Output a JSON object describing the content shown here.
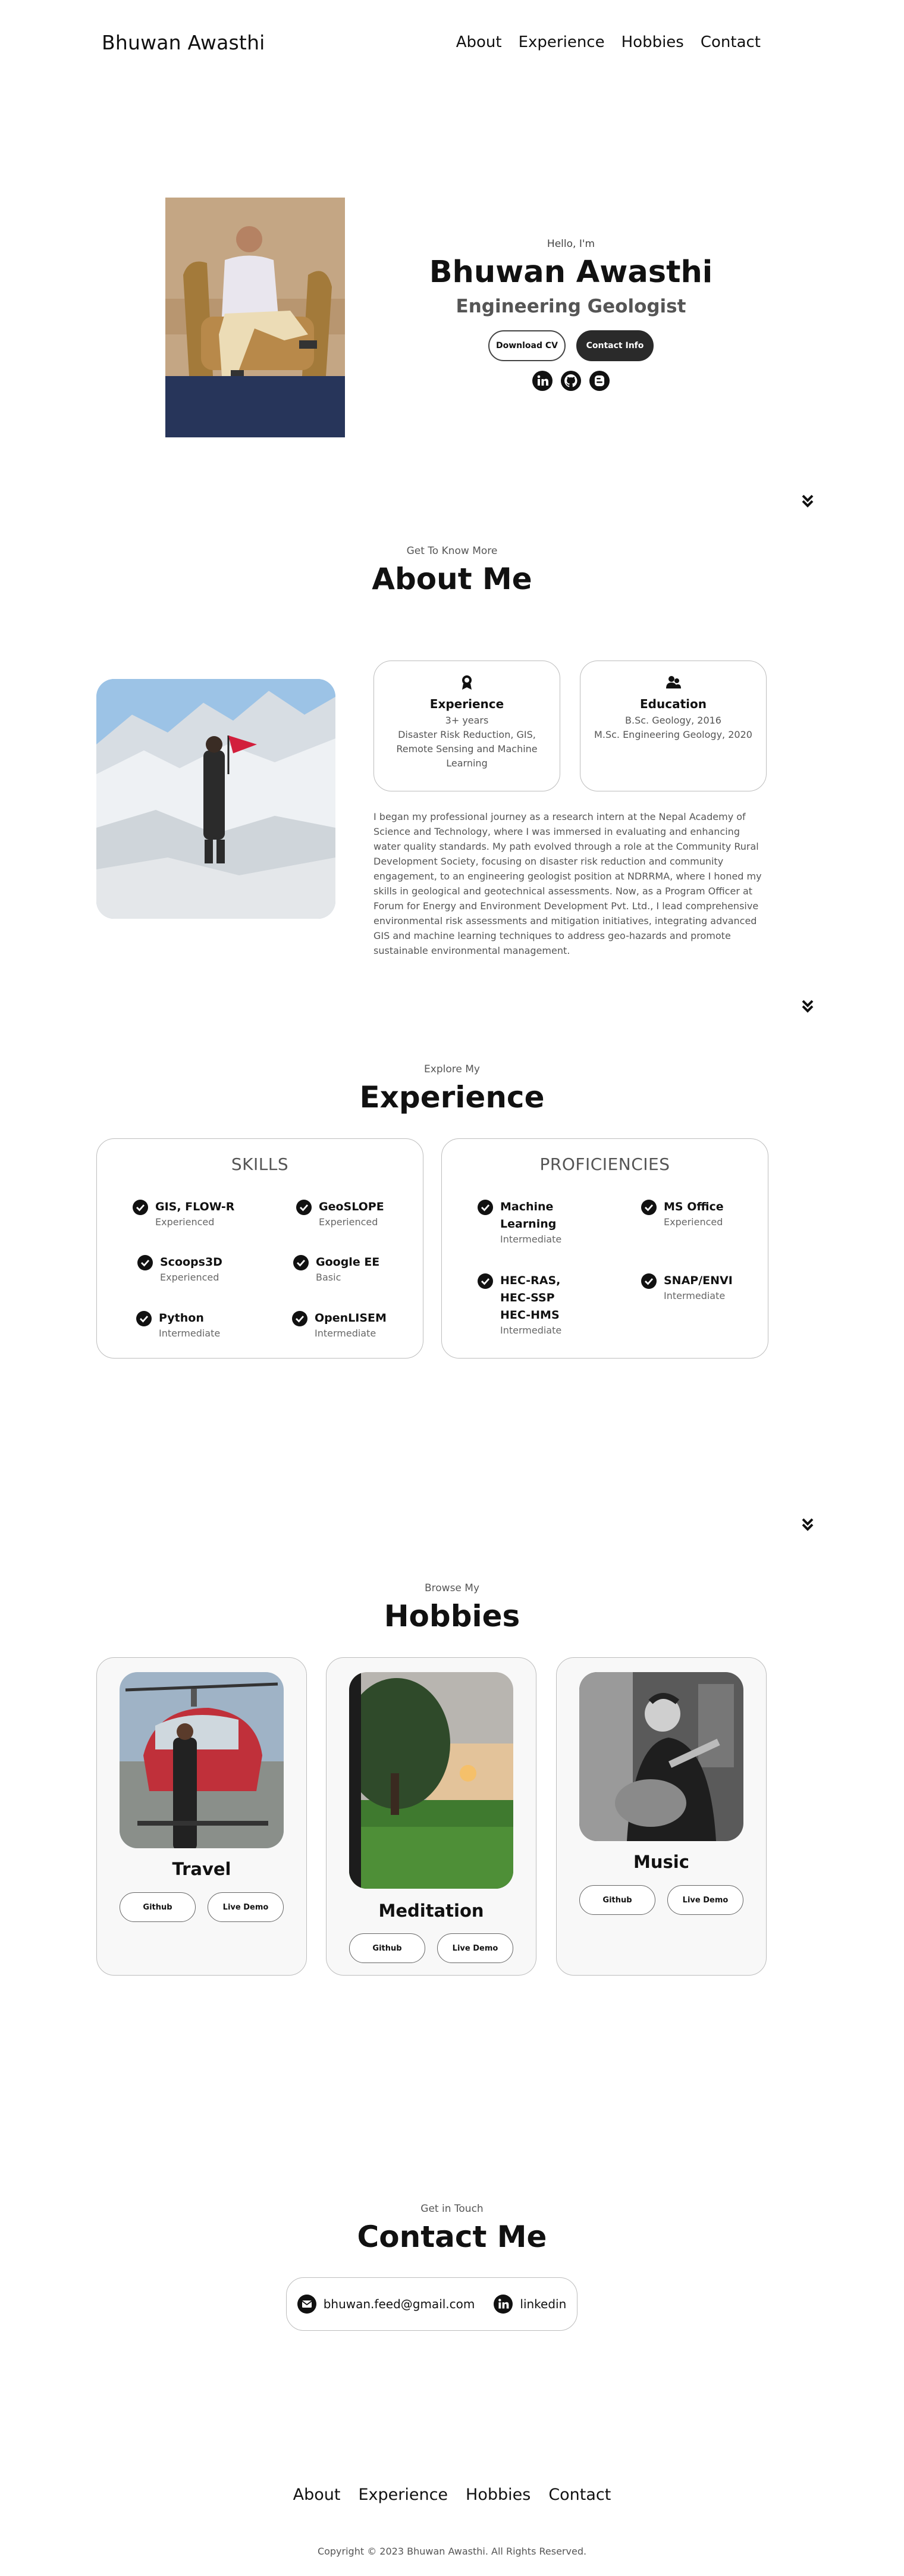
{
  "nav": {
    "logo": "Bhuwan Awasthi",
    "links": [
      "About",
      "Experience",
      "Hobbies",
      "Contact"
    ]
  },
  "hero": {
    "greeting": "Hello, I'm",
    "name": "Bhuwan Awasthi",
    "role": "Engineering Geologist",
    "download_cv": "Download CV",
    "contact_info": "Contact Info",
    "social_icons": [
      "linkedin-icon",
      "github-icon",
      "blog-icon"
    ]
  },
  "about": {
    "subtitle": "Get To Know More",
    "title": "About Me",
    "experience": {
      "title": "Experience",
      "years": "3+ years",
      "detail_1": "Disaster Risk Reduction, GIS,",
      "detail_2": "Remote Sensing and Machine",
      "detail_3": "Learning"
    },
    "education": {
      "title": "Education",
      "line_1": "B.Sc. Geology, 2016",
      "line_2": "M.Sc. Engineering Geology, 2020"
    },
    "paragraph": "I began my professional journey as a research intern at the Nepal Academy of Science and Technology, where I was immersed in evaluating and enhancing water quality standards. My path evolved through a role at the Community Rural Development Society, focusing on disaster risk reduction and community engagement, to an engineering geologist position at NDRRMA, where I honed my skills in geological and geotechnical assessments. Now, as a Program Officer at Forum for Energy and Environment Development Pvt. Ltd., I lead comprehensive environmental risk assessments and mitigation initiatives, integrating advanced GIS and machine learning techniques to address geo-hazards and promote sustainable environmental management."
  },
  "experience": {
    "subtitle": "Explore My",
    "title": "Experience",
    "skills_title": "SKILLS",
    "skills": [
      {
        "name": "GIS, FLOW-R",
        "level": "Experienced"
      },
      {
        "name": "GeoSLOPE",
        "level": "Experienced"
      },
      {
        "name": "Scoops3D",
        "level": "Experienced"
      },
      {
        "name": "Google EE",
        "level": "Basic"
      },
      {
        "name": "Python",
        "level": "Intermediate"
      },
      {
        "name": "OpenLISEM",
        "level": "Intermediate"
      }
    ],
    "proficiencies_title": "PROFICIENCIES",
    "proficiencies": [
      {
        "name_1": "Machine",
        "name_2": "Learning",
        "level": "Intermediate"
      },
      {
        "name": "MS Office",
        "level": "Experienced"
      },
      {
        "name_1": "HEC-RAS,",
        "name_2": "HEC-SSP",
        "name_3": "HEC-HMS",
        "level": "Intermediate"
      },
      {
        "name": "SNAP/ENVI",
        "level": "Intermediate"
      }
    ]
  },
  "hobbies": {
    "subtitle": "Browse My",
    "title": "Hobbies",
    "items": [
      {
        "title": "Travel",
        "github": "Github",
        "demo": "Live Demo"
      },
      {
        "title": "Meditation",
        "github": "Github",
        "demo": "Live Demo"
      },
      {
        "title": "Music",
        "github": "Github",
        "demo": "Live Demo"
      }
    ]
  },
  "contact": {
    "subtitle": "Get in Touch",
    "title": "Contact Me",
    "email": "bhuwan.feed@gmail.com",
    "linkedin": "linkedin"
  },
  "footer": {
    "links": [
      "About",
      "Experience",
      "Hobbies",
      "Contact"
    ],
    "copyright": "Copyright © 2023 Bhuwan Awasthi. All Rights Reserved."
  }
}
